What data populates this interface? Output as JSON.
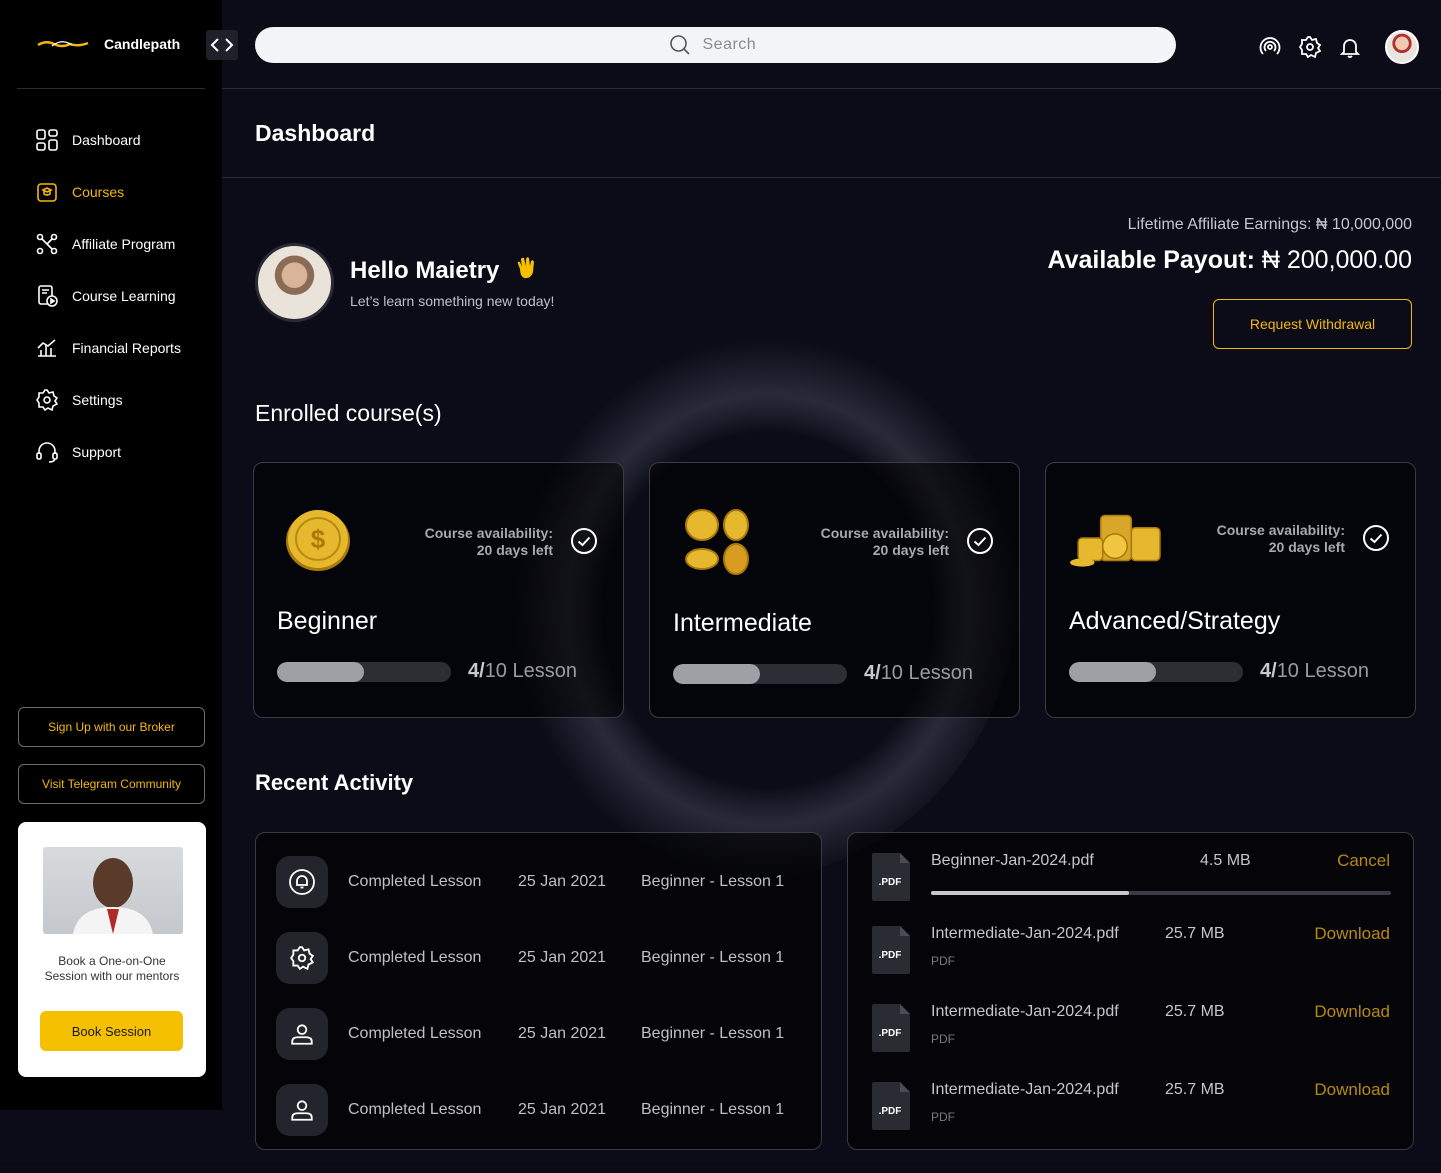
{
  "brand": {
    "name": "Candlepath"
  },
  "search": {
    "placeholder": "Search"
  },
  "sidebar": {
    "items": [
      {
        "label": "Dashboard",
        "icon": "grid-icon",
        "active": false
      },
      {
        "label": "Courses",
        "icon": "courses-icon",
        "active": true
      },
      {
        "label": "Affiliate Program",
        "icon": "network-icon",
        "active": false
      },
      {
        "label": "Course Learning",
        "icon": "video-doc-icon",
        "active": false
      },
      {
        "label": "Financial Reports",
        "icon": "chart-icon",
        "active": false
      },
      {
        "label": "Settings",
        "icon": "gear-icon",
        "active": false
      },
      {
        "label": "Support",
        "icon": "headset-icon",
        "active": false
      }
    ],
    "broker_btn": "Sign Up with our Broker",
    "telegram_btn": "Visit Telegram Community",
    "mentor": {
      "text": "Book a One-on-One Session with our mentors",
      "button": "Book Session"
    }
  },
  "page": {
    "title": "Dashboard"
  },
  "greeting": {
    "hello": "Hello Maietry",
    "subtitle": "Let’s learn something new today!"
  },
  "earnings": {
    "lifetime": "Lifetime Affiliate Earnings: ₦ 10,000,000",
    "payout_label": "Available Payout:",
    "payout_value": "₦ 200,000.00",
    "withdraw_btn": "Request Withdrawal"
  },
  "enrolled": {
    "title": "Enrolled course(s)",
    "courses": [
      {
        "name": "Beginner",
        "avail_line1": "Course availability:",
        "avail_line2": "20 days left",
        "progress": 0.5,
        "done": "4/",
        "total": "10 Lesson"
      },
      {
        "name": "Intermediate",
        "avail_line1": "Course availability:",
        "avail_line2": "20 days left",
        "progress": 0.5,
        "done": "4/",
        "total": "10 Lesson"
      },
      {
        "name": "Advanced/Strategy",
        "avail_line1": "Course availability:",
        "avail_line2": "20 days left",
        "progress": 0.5,
        "done": "4/",
        "total": "10 Lesson"
      }
    ]
  },
  "activity": {
    "title": "Recent Activity",
    "rows": [
      {
        "icon": "bell-icon",
        "text": "Completed Lesson",
        "date": "25 Jan 2021",
        "lesson": "Beginner - Lesson 1"
      },
      {
        "icon": "gear-icon",
        "text": "Completed Lesson",
        "date": "25 Jan 2021",
        "lesson": "Beginner - Lesson 1"
      },
      {
        "icon": "user-icon",
        "text": "Completed Lesson",
        "date": "25 Jan 2021",
        "lesson": "Beginner - Lesson 1"
      },
      {
        "icon": "user-icon",
        "text": "Completed Lesson",
        "date": "25 Jan 2021",
        "lesson": "Beginner - Lesson 1"
      }
    ]
  },
  "files": {
    "icon_label": ".PDF",
    "rows": [
      {
        "name": "Beginner-Jan-2024.pdf",
        "size": "4.5 MB",
        "action": "Cancel",
        "progress": 0.43,
        "type": ""
      },
      {
        "name": "Intermediate-Jan-2024.pdf",
        "size": "25.7 MB",
        "action": "Download",
        "type": "PDF"
      },
      {
        "name": "Intermediate-Jan-2024.pdf",
        "size": "25.7 MB",
        "action": "Download",
        "type": "PDF"
      },
      {
        "name": "Intermediate-Jan-2024.pdf",
        "size": "25.7 MB",
        "action": "Download",
        "type": "PDF"
      }
    ]
  },
  "colors": {
    "accent": "#f5b70b",
    "background": "#0b0c18",
    "sidebar": "#000000"
  }
}
